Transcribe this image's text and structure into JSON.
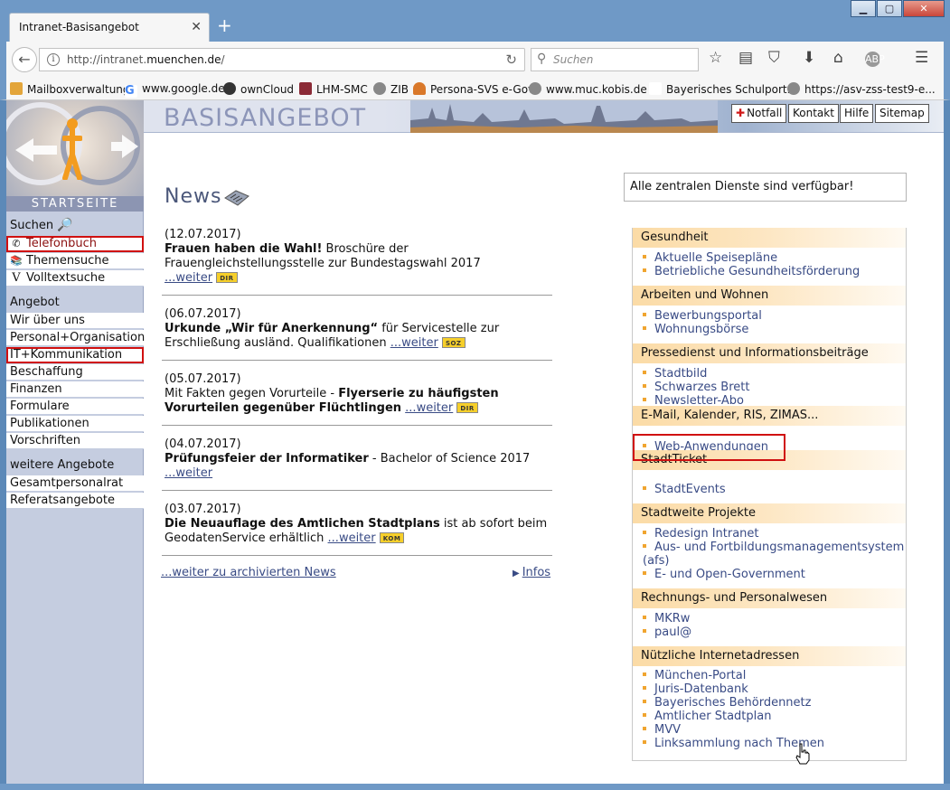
{
  "browser": {
    "tab_title": "Intranet-Basisangebot",
    "url_prefix": "http://intranet.",
    "url_domain": "muenchen.de",
    "url_suffix": "/",
    "search_placeholder": "Suchen",
    "bookmarks": [
      "Mailboxverwaltung",
      "www.google.de",
      "ownCloud",
      "LHM-SMC",
      "ZIB",
      "Persona-SVS e-Gov",
      "www.muc.kobis.de",
      "Bayerisches Schulport...",
      "https://asv-zss-test9-e..."
    ]
  },
  "header": {
    "title": "BASISANGEBOT",
    "buttons": [
      "Notfall",
      "Kontakt",
      "Hilfe",
      "Sitemap"
    ]
  },
  "sidebar": {
    "startseite": "STARTSEITE",
    "suchen_head": "Suchen",
    "suchen_items": [
      "Telefonbuch",
      "Themensuche",
      "Volltextsuche"
    ],
    "angebot_head": "Angebot",
    "angebot_items": [
      "Wir über uns",
      "Personal+Organisation",
      "IT+Kommunikation",
      "Beschaffung",
      "Finanzen",
      "Formulare",
      "Publikationen",
      "Vorschriften"
    ],
    "weitere_head": "weitere Angebote",
    "weitere_items": [
      "Gesamtpersonalrat",
      "Referatsangebote"
    ]
  },
  "news": {
    "title": "News",
    "more_label": "...weiter",
    "items": [
      {
        "date": "(12.07.2017)",
        "bold": "Frauen haben die Wahl!",
        "text": " Broschüre der Frauengleichstellungsstelle zur Bundestagswahl 2017",
        "tag": "DIR"
      },
      {
        "date": "(06.07.2017)",
        "bold": "Urkunde „Wir für Anerkennung“",
        "text": " für Servicestelle zur Erschließung ausländ. Qualifikationen",
        "tag": "SOZ"
      },
      {
        "date": "(05.07.2017)",
        "pre": "Mit Fakten gegen Vorurteile - ",
        "bold": "Flyerserie zu häufigsten Vorurteilen gegenüber Flüchtlingen",
        "tag": "DIR"
      },
      {
        "date": "(04.07.2017)",
        "bold": "Prüfungsfeier der Informatiker",
        "text": " - Bachelor of Science 2017",
        "tag": ""
      },
      {
        "date": "(03.07.2017)",
        "bold": "Die Neuauflage des Amtlichen Stadtplans",
        "text": " ist ab sofort beim GeodatenService erhältlich",
        "tag": "KOM"
      }
    ],
    "archive_link": "...weiter zu archivierten News",
    "infos_link": "Infos"
  },
  "status": "Alle zentralen Dienste sind verfügbar!",
  "right": {
    "sections": [
      {
        "title": "Gesundheit",
        "links": [
          "Aktuelle Speisepläne",
          "Betriebliche Gesundheitsförderung"
        ]
      },
      {
        "title": "Arbeiten und Wohnen",
        "links": [
          "Bewerbungsportal",
          "Wohnungsbörse"
        ]
      },
      {
        "title": "Pressedienst und Informationsbeiträge",
        "links": [
          "Stadtbild",
          "Schwarzes Brett",
          "Newsletter-Abo"
        ]
      },
      {
        "title": "E-Mail, Kalender, RIS, ZIMAS...",
        "links": [
          "Web-Anwendungen"
        ]
      },
      {
        "title": "StadtTicket",
        "links": [
          "StadtEvents"
        ]
      },
      {
        "title": "Stadtweite Projekte",
        "links": [
          "Redesign Intranet",
          "Aus- und Fortbildungsmanagementsystem (afs)",
          "E- und Open-Government"
        ]
      },
      {
        "title": "Rechnungs- und Personalwesen",
        "links": [
          "MKRw",
          "paul@"
        ]
      },
      {
        "title": "Nützliche Internetadressen",
        "links": [
          "München-Portal",
          "Juris-Datenbank",
          "Bayerisches Behördennetz",
          "Amtlicher Stadtplan",
          "MVV",
          "Linksammlung nach Themen"
        ]
      }
    ]
  }
}
